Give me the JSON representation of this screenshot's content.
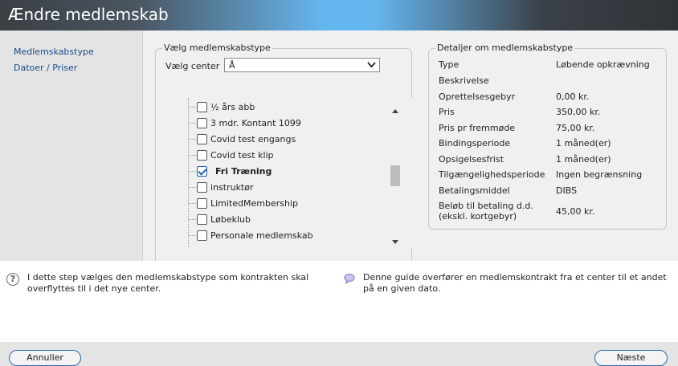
{
  "window": {
    "title": "Ændre medlemskab"
  },
  "sidebar": {
    "items": [
      {
        "label": "Medlemskabstype"
      },
      {
        "label": "Datoer / Priser"
      }
    ]
  },
  "select_group": {
    "legend": "Vælg medlemskabstype",
    "center_label": "Vælg center",
    "center_value": "Å",
    "tree": [
      {
        "label": "½ års abb",
        "checked": false
      },
      {
        "label": "3 mdr. Kontant 1099",
        "checked": false
      },
      {
        "label": "Covid test engangs",
        "checked": false
      },
      {
        "label": "Covid test klip",
        "checked": false
      },
      {
        "label": "Fri Træning",
        "checked": true
      },
      {
        "label": "instruktør",
        "checked": false
      },
      {
        "label": "LimitedMembership",
        "checked": false
      },
      {
        "label": "Løbeklub",
        "checked": false
      },
      {
        "label": "Personale medlemskab",
        "checked": false
      }
    ]
  },
  "details": {
    "legend": "Detaljer om medlemskabstype",
    "rows": [
      {
        "key": "Type",
        "value": "Løbende opkrævning"
      },
      {
        "key": "Beskrivelse",
        "value": ""
      },
      {
        "key": "Oprettelsesgebyr",
        "value": "0,00 kr."
      },
      {
        "key": "Pris",
        "value": "350,00 kr."
      },
      {
        "key": "Pris pr fremmøde",
        "value": "75,00 kr."
      },
      {
        "key": "Bindingsperiode",
        "value": "1 måned(er)"
      },
      {
        "key": "Opsigelsesfrist",
        "value": "1 måned(er)"
      },
      {
        "key": "Tilgængelighedsperiode",
        "value": "Ingen begrænsning"
      },
      {
        "key": "Betalingsmiddel",
        "value": "DIBS"
      },
      {
        "key": "Beløb til betaling d.d. (ekskl. kortgebyr)",
        "value": "45,00 kr."
      }
    ]
  },
  "help": {
    "step_text": "I dette step vælges den medlemskabstype som kontrakten skal overflyttes til i det nye center.",
    "guide_text": "Denne guide overfører en medlemskontrakt fra et center til et andet på en given dato."
  },
  "footer": {
    "cancel_label": "Annuller",
    "next_label": "Næste"
  },
  "icons": {
    "help": "question-circle-icon",
    "guide": "speech-bubble-icon",
    "dropdown": "chevron-down-icon"
  },
  "colors": {
    "accent": "#2b6cb0",
    "link": "#1a4d8c"
  }
}
